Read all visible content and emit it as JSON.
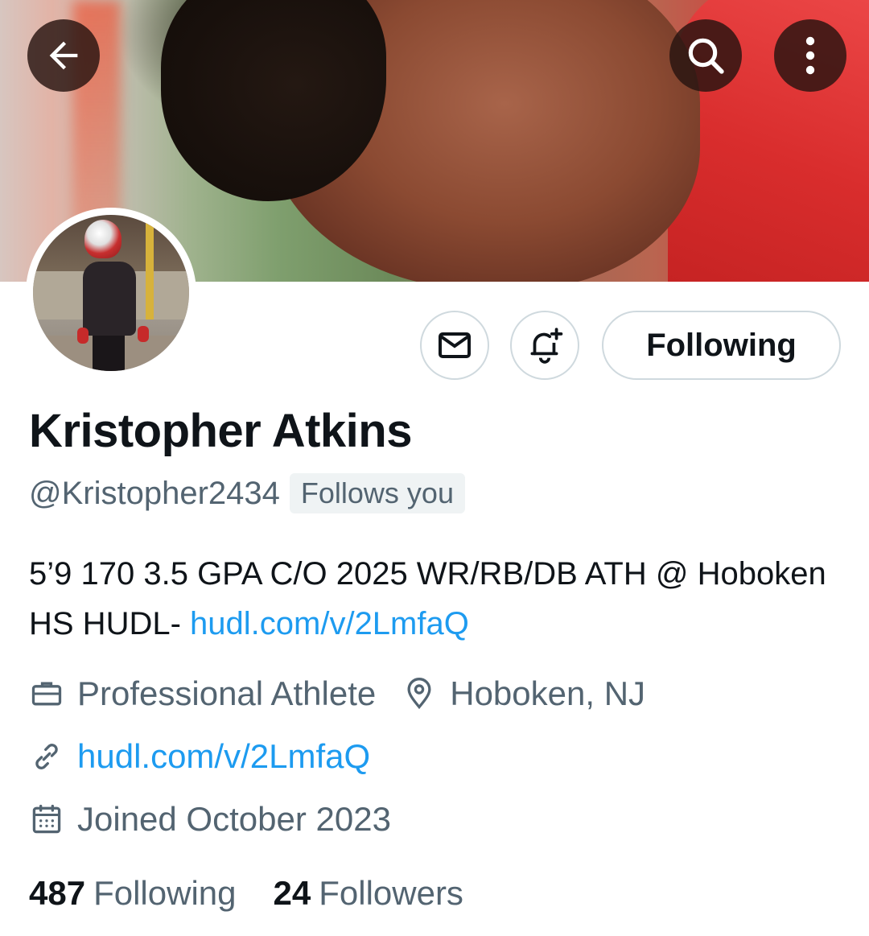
{
  "header": {
    "back_icon": "arrow-left-icon",
    "search_icon": "search-icon",
    "more_icon": "more-vertical-icon"
  },
  "actions": {
    "message_icon": "envelope-icon",
    "notify_icon": "bell-plus-icon",
    "follow_label": "Following"
  },
  "profile": {
    "name": "Kristopher Atkins",
    "handle": "@Kristopher2434",
    "follows_badge": "Follows you",
    "bio_text": "5’9 170 3.5 GPA C/O 2025 WR/RB/DB ATH @ Hoboken HS HUDL- ",
    "bio_link": "hudl.com/v/2LmfaQ",
    "profession": "Professional Athlete",
    "location": "Hoboken, NJ",
    "website": "hudl.com/v/2LmfaQ",
    "joined": "Joined October 2023"
  },
  "stats": {
    "following_count": "487",
    "following_label": "Following",
    "followers_count": "24",
    "followers_label": "Followers"
  },
  "colors": {
    "link": "#1d9bf0",
    "secondary_text": "#536471",
    "primary_text": "#0f1419",
    "border": "#cfd9de"
  }
}
